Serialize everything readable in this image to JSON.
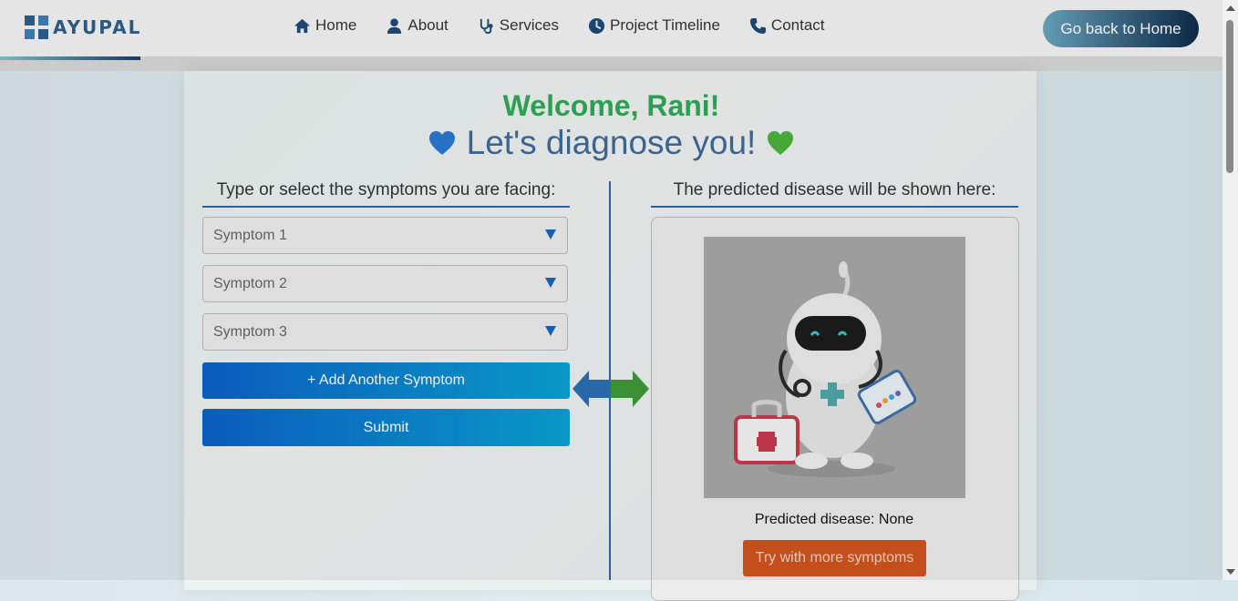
{
  "brand": {
    "name": "AYUPAL",
    "primary_color": "#1e4a7a"
  },
  "nav": {
    "items": [
      {
        "label": "Home",
        "icon": "home-icon"
      },
      {
        "label": "About",
        "icon": "user-icon"
      },
      {
        "label": "Services",
        "icon": "stethoscope-icon"
      },
      {
        "label": "Project Timeline",
        "icon": "clock-icon"
      },
      {
        "label": "Contact",
        "icon": "phone-icon"
      }
    ],
    "back_button": "Go back to Home"
  },
  "main": {
    "welcome": "Welcome, Rani!",
    "subtitle": "Let's diagnose you!",
    "left_title": "Type or select the symptoms you are facing:",
    "right_title": "The predicted disease will be shown here:",
    "symptoms": [
      {
        "placeholder": "Symptom 1"
      },
      {
        "placeholder": "Symptom 2"
      },
      {
        "placeholder": "Symptom 3"
      }
    ],
    "add_symptom_button": "+ Add Another Symptom",
    "submit_button": "Submit",
    "predicted_text": "Predicted disease: None",
    "try_button": "Try with more symptoms"
  },
  "colors": {
    "welcome_green": "#2faa57",
    "subtitle_blue": "#3e6a9c",
    "button_blue": "#0c62c8",
    "try_orange": "#d2541e"
  }
}
